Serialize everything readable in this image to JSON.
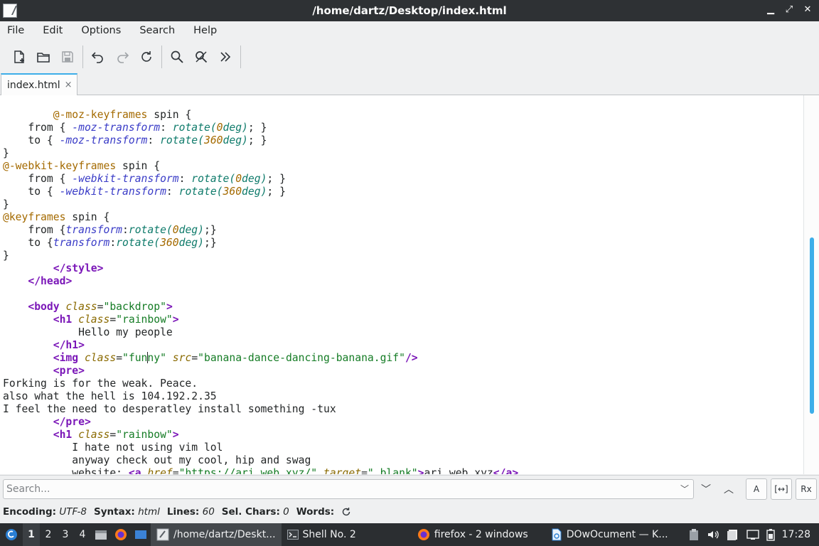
{
  "window": {
    "title": "/home/dartz/Desktop/index.html"
  },
  "menu": [
    "File",
    "Edit",
    "Options",
    "Search",
    "Help"
  ],
  "tab": {
    "label": "index.html",
    "close": "×"
  },
  "search": {
    "placeholder": "Search...",
    "case_label": "A",
    "regex_label": "Rx",
    "selection_label": "[↔]"
  },
  "status": {
    "encoding_label": "Encoding:",
    "encoding": "UTF-8",
    "syntax_label": "Syntax:",
    "syntax": "html",
    "lines_label": "Lines:",
    "lines": "60",
    "selchars_label": "Sel. Chars:",
    "selchars": "0",
    "words_label": "Words:"
  },
  "taskbar": {
    "workspaces": [
      "1",
      "2",
      "3",
      "4"
    ],
    "tasks": [
      "/home/dartz/Deskt...",
      "Shell No. 2",
      "firefox - 2 windows",
      "DOwOcument — K..."
    ],
    "clock": "17:28"
  },
  "code_lines": [
    "        @-moz-keyframes spin {",
    "    from { -moz-transform: rotate(0deg); }",
    "    to { -moz-transform: rotate(360deg); }",
    "}",
    "@-webkit-keyframes spin {",
    "    from { -webkit-transform: rotate(0deg); }",
    "    to { -webkit-transform: rotate(360deg); }",
    "}",
    "@keyframes spin {",
    "    from {transform:rotate(0deg);}",
    "    to {transform:rotate(360deg);}",
    "}",
    "        </style>",
    "    </head>",
    "",
    "    <body class=\"backdrop\">",
    "        <h1 class=\"rainbow\">",
    "            Hello my people",
    "        </h1>",
    "        <img class=\"funny\" src=\"banana-dance-dancing-banana.gif\"/>",
    "        <pre>",
    "Forking is for the weak. Peace.",
    "also what the hell is 104.192.2.35",
    "I feel the need to desperatley install something -tux",
    "        </pre>",
    "        <h1 class=\"rainbow\">",
    "           I hate not using vim lol",
    "           anyway check out my cool, hip and swag",
    "           website: <a href=\"https://ari.web.xyz/\" target=\"_blank\">ari.web.xyz</a>"
  ],
  "colors": {
    "accent": "#3daee9",
    "tag": "#7b17b8",
    "string": "#157c25",
    "keyword": "#a46a00",
    "property": "#3a3cc7",
    "function": "#0f7b6b"
  }
}
